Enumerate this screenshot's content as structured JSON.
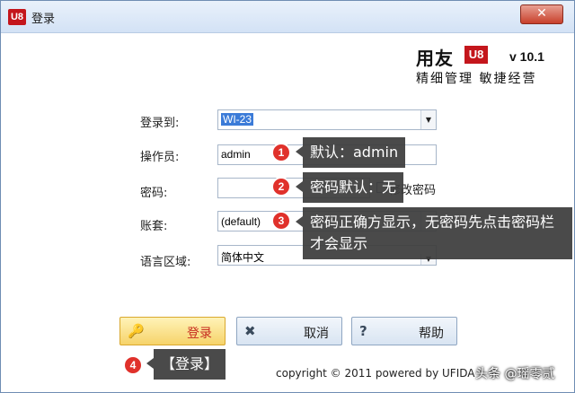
{
  "window": {
    "title": "登录",
    "app_icon": "U8",
    "close_glyph": "✕"
  },
  "brand": {
    "name": "用友",
    "logo": "U8",
    "version": "v 10.1",
    "slogan": "精细管理 敏捷经营"
  },
  "form": {
    "server": {
      "label": "登录到:",
      "value": "WI-23"
    },
    "operator": {
      "label": "操作员:",
      "value": "admin"
    },
    "password": {
      "label": "密码:",
      "value": ""
    },
    "change_password": {
      "label": "修改密码",
      "checked": false
    },
    "account": {
      "label": "账套:",
      "value": "(default)"
    },
    "language": {
      "label": "语言区域:",
      "value": "简体中文"
    }
  },
  "callouts": [
    {
      "num": "1",
      "text": "默认：admin"
    },
    {
      "num": "2",
      "text": "密码默认：无"
    },
    {
      "num": "3",
      "text": "密码正确方显示，无密码先点击密码栏才会显示"
    },
    {
      "num": "4",
      "text": "【登录】"
    }
  ],
  "buttons": {
    "login": {
      "label": "登录",
      "icon": "key-icon",
      "glyph": "🔑"
    },
    "cancel": {
      "label": "取消",
      "icon": "close-icon",
      "glyph": "✖"
    },
    "help": {
      "label": "帮助",
      "icon": "help-icon",
      "glyph": "?"
    }
  },
  "footer": {
    "copyright": "copyright © 2011 powered by UFIDA",
    "watermark": "头条 @瑶零贰"
  },
  "colors": {
    "brand_red": "#c4161c",
    "callout_bg": "#3c3c3c",
    "badge_red": "#e0312b",
    "login_button": "#f6d36a",
    "selection": "#3b7bd8"
  }
}
